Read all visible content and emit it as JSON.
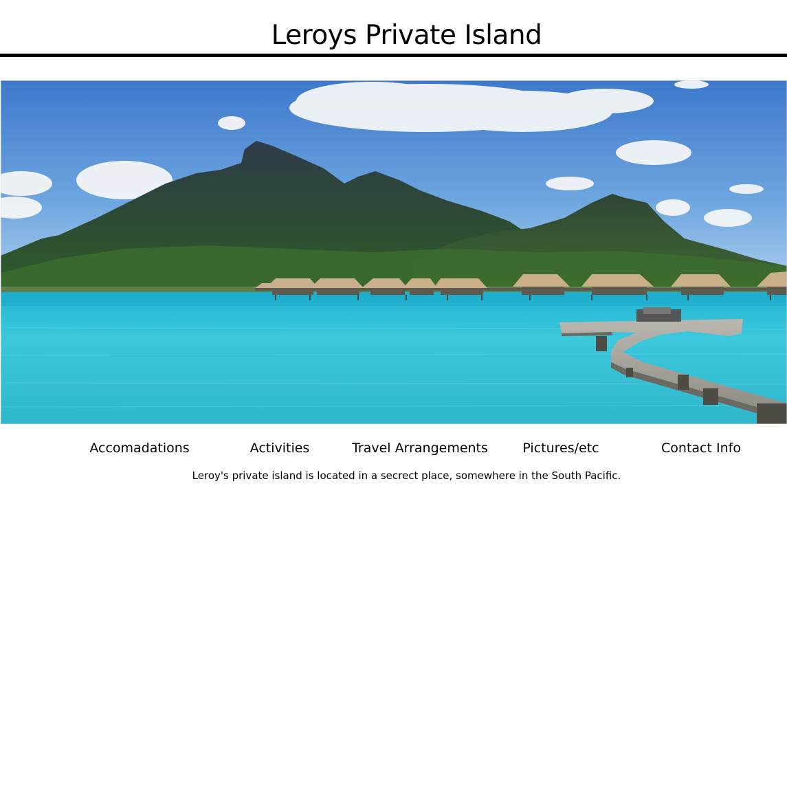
{
  "header": {
    "title": "Leroys Private Island"
  },
  "hero": {
    "subject": "tropical lagoon with mountain, overwater bungalows and wooden pier"
  },
  "nav": {
    "items": [
      {
        "label": "Accomadations"
      },
      {
        "label": "Activities"
      },
      {
        "label": "Travel Arrangements"
      },
      {
        "label": "Pictures/etc"
      },
      {
        "label": "Contact Info"
      }
    ]
  },
  "content": {
    "intro": "Leroy's private island is located in a secrect place, somewhere in the South Pacific."
  },
  "colors": {
    "background": "#ffffff",
    "text": "#000000",
    "rule": "#000000"
  }
}
